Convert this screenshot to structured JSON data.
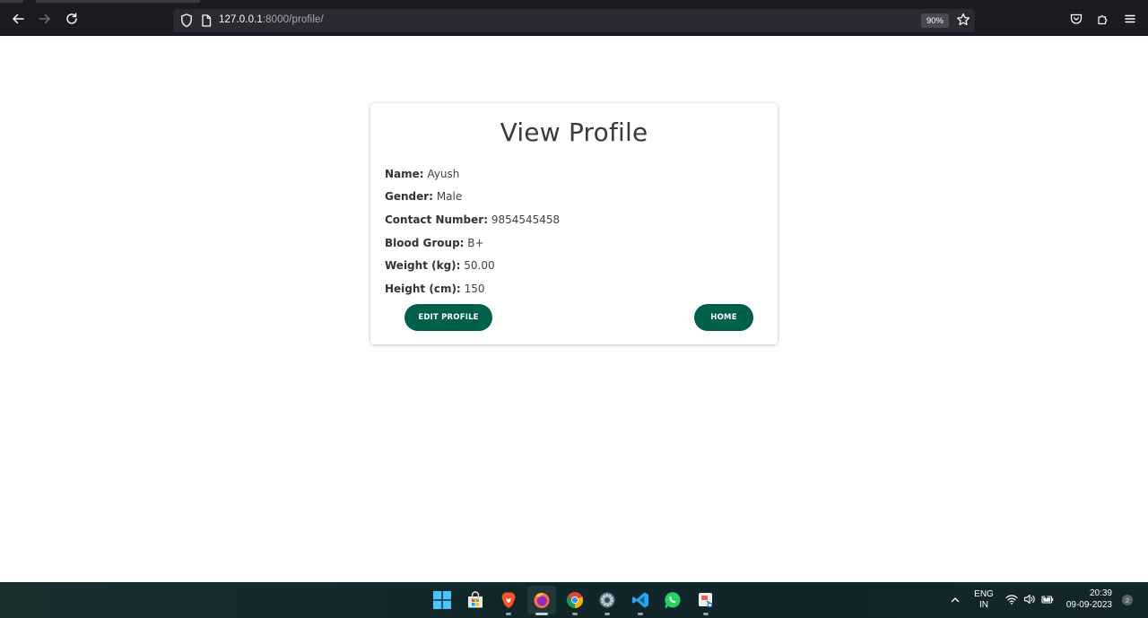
{
  "browser": {
    "url_host": "127.0.0.1",
    "url_rest": ":8000/profile/",
    "zoom": "90%"
  },
  "profile": {
    "title": "View Profile",
    "fields": [
      {
        "label": "Name:",
        "value": "Ayush"
      },
      {
        "label": "Gender:",
        "value": "Male"
      },
      {
        "label": "Contact Number:",
        "value": "9854545458"
      },
      {
        "label": "Blood Group:",
        "value": "B+"
      },
      {
        "label": "Weight (kg):",
        "value": "50.00"
      },
      {
        "label": "Height (cm):",
        "value": "150"
      }
    ],
    "edit_button": "EDIT PROFILE",
    "home_button": "HOME",
    "accent_color": "#00604c"
  },
  "taskbar": {
    "apps": [
      "start-icon",
      "microsoft-store-icon",
      "brave-icon",
      "firefox-icon",
      "chrome-icon",
      "settings-icon",
      "vscode-icon",
      "whatsapp-icon",
      "snipping-tool-icon"
    ],
    "language_line1": "ENG",
    "language_line2": "IN",
    "time": "20:39",
    "date": "09-09-2023",
    "notification_count": "2"
  }
}
